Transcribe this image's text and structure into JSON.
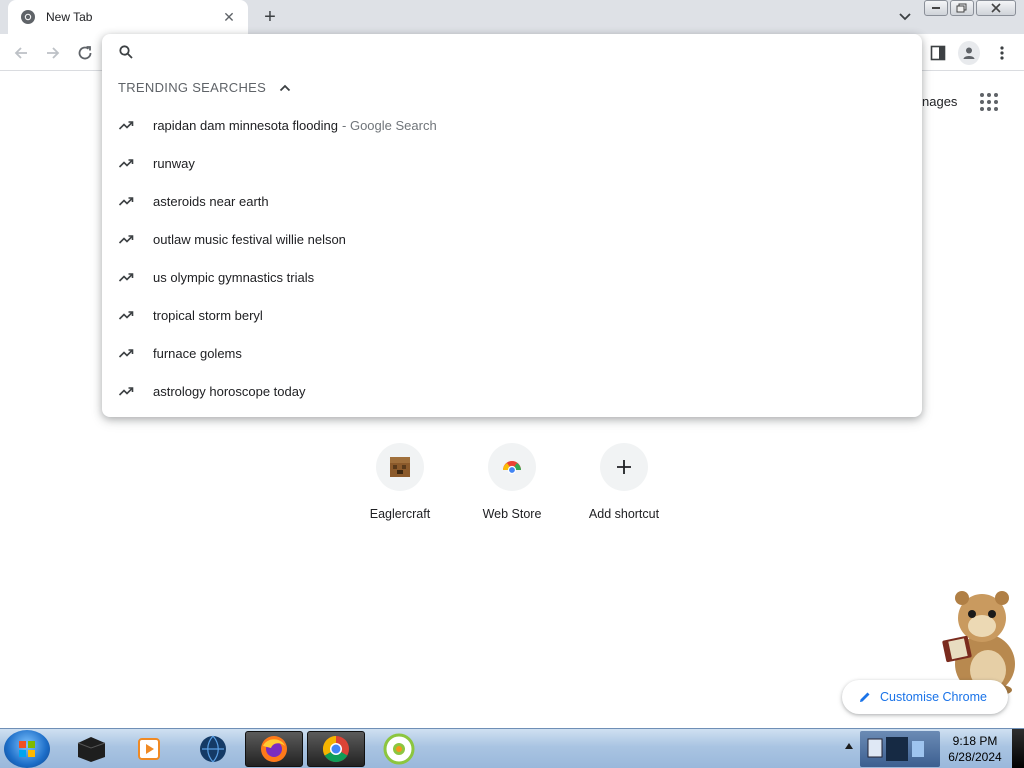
{
  "browser": {
    "tab_title": "New Tab",
    "tab_close_glyph": "✕",
    "new_tab_glyph": "+"
  },
  "window_controls": [
    "minimize",
    "restore",
    "close"
  ],
  "toolbar": {
    "icons": [
      "back-icon",
      "forward-icon",
      "reload-icon",
      "side-panel-icon",
      "profile-icon",
      "menu-icon"
    ]
  },
  "ntp": {
    "images_label": "nages",
    "shortcuts": [
      {
        "label": "Eaglercraft",
        "icon": "eaglercraft-icon"
      },
      {
        "label": "Web Store",
        "icon": "webstore-icon"
      },
      {
        "label": "Add shortcut",
        "icon": "plus-icon",
        "glyph": "+"
      }
    ],
    "customise_label": "Customise Chrome"
  },
  "omnibox": {
    "value": "",
    "trending_header": "TRENDING SEARCHES",
    "suggestions": [
      {
        "text": "rapidan dam minnesota flooding",
        "suffix": "- Google Search"
      },
      {
        "text": "runway",
        "suffix": ""
      },
      {
        "text": "asteroids near earth",
        "suffix": ""
      },
      {
        "text": "outlaw music festival willie nelson",
        "suffix": ""
      },
      {
        "text": "us olympic gymnastics trials",
        "suffix": ""
      },
      {
        "text": "tropical storm beryl",
        "suffix": ""
      },
      {
        "text": "furnace golems",
        "suffix": ""
      },
      {
        "text": "astrology horoscope today",
        "suffix": ""
      }
    ]
  },
  "taskbar": {
    "apps": [
      "terminal-icon",
      "media-player-icon",
      "globe-icon",
      "firefox-icon",
      "chrome-icon",
      "app-icon"
    ],
    "clock_time": "9:18 PM",
    "clock_date": "6/28/2024"
  },
  "colors": {
    "accent": "#1a73e8",
    "tabstrip": "#dee1e6"
  }
}
